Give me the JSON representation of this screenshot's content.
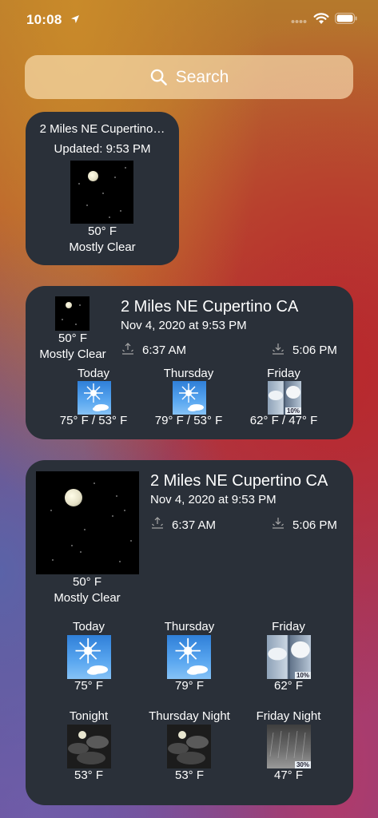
{
  "status": {
    "time": "10:08"
  },
  "search": {
    "label": "Search"
  },
  "small": {
    "location": "2 Miles NE Cupertino…",
    "updated": "Updated: 9:53 PM",
    "temp": "50° F",
    "condition": "Mostly Clear"
  },
  "medium": {
    "temp": "50° F",
    "condition": "Mostly Clear",
    "location": "2 Miles NE Cupertino CA",
    "date": "Nov 4, 2020 at 9:53 PM",
    "sunrise": "6:37 AM",
    "sunset": "5:06 PM",
    "forecast": [
      {
        "day": "Today",
        "temps": "75° F / 53° F",
        "icon": "sunny-icon"
      },
      {
        "day": "Thursday",
        "temps": "79° F / 53° F",
        "icon": "sunny-icon"
      },
      {
        "day": "Friday",
        "temps": "62° F / 47° F",
        "icon": "cloudy-icon",
        "pct": "10%"
      }
    ]
  },
  "large": {
    "temp": "50° F",
    "condition": "Mostly Clear",
    "location": "2 Miles NE Cupertino CA",
    "date": "Nov 4, 2020 at 9:53 PM",
    "sunrise": "6:37 AM",
    "sunset": "5:06 PM",
    "days": [
      {
        "day": "Today",
        "temp": "75° F",
        "icon": "sunny-icon"
      },
      {
        "day": "Thursday",
        "temp": "79° F",
        "icon": "sunny-icon"
      },
      {
        "day": "Friday",
        "temp": "62° F",
        "icon": "cloudy-icon",
        "pct": "10%"
      }
    ],
    "nights": [
      {
        "day": "Tonight",
        "temp": "53° F",
        "icon": "partly-cloudy-night-icon"
      },
      {
        "day": "Thursday Night",
        "temp": "53° F",
        "icon": "partly-cloudy-night-icon"
      },
      {
        "day": "Friday Night",
        "temp": "47° F",
        "icon": "rain-icon",
        "pct": "30%"
      }
    ]
  }
}
